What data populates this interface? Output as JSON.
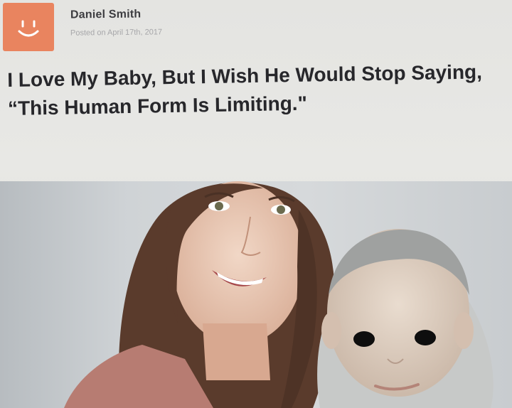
{
  "post": {
    "author": "Daniel Smith",
    "posted": "Posted on April 17th, 2017",
    "headline": "I Love My Baby, But I Wish He Would Stop Saying, “This Human Form Is Limiting.\""
  },
  "avatar": {
    "icon": "smiley-face-icon",
    "color": "#e9845f"
  }
}
